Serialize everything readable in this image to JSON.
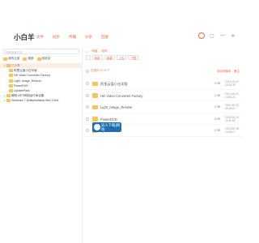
{
  "app": {
    "name": "小白羊"
  },
  "tabs": [
    "文件",
    "同步",
    "传输",
    "分享",
    "回收"
  ],
  "left": {
    "search_placeholder": "网盘搜索文件",
    "libraries": [
      "我的云盘",
      "相册",
      "回收站"
    ],
    "tree": [
      {
        "label": "已分享",
        "level": 0,
        "selected": true
      },
      {
        "label": "阿里云盘小白羊版",
        "level": 1
      },
      {
        "label": "HD Video Converter Factory",
        "level": 1
      },
      {
        "label": "Light_Image_Resizer",
        "level": 1
      },
      {
        "label": "PowerDVD",
        "level": 1
      },
      {
        "label": "UpdatePack",
        "level": 1
      },
      {
        "label": "微软.NET网络运行库合集",
        "level": 0
      },
      {
        "label": "Windows 7 Multipleditions Mini 10in1",
        "level": 0
      }
    ]
  },
  "right": {
    "crumb": [
      "网盘",
      "软件"
    ],
    "toolbar": [
      "刷新",
      "新建",
      "上传",
      "下载"
    ],
    "count_label": "已选中 0 / 5 个",
    "sort": [
      "按名称降序",
      "备注"
    ],
    "rows": [
      {
        "name": "阿里云盘小白羊版",
        "size": "0.0B",
        "date": "2021-08-22\n15:30:35"
      },
      {
        "name": "HD Video Converter Factory",
        "size": "0.0B",
        "date": "2021-08-22\n10:50:21"
      },
      {
        "name": "Light_Image_Resizer",
        "size": "0.0B",
        "date": "2021-08-22\n09:05:57"
      },
      {
        "name": "PowerDVD",
        "size": "0.0B",
        "date": "2021-08-10\n11:50:56"
      },
      {
        "name": "UpdatePack",
        "size": "0.0B",
        "date": "2021-09-18\n14:36:07"
      }
    ]
  },
  "watermark": {
    "line1": "异人下载",
    "line2": "网站"
  }
}
